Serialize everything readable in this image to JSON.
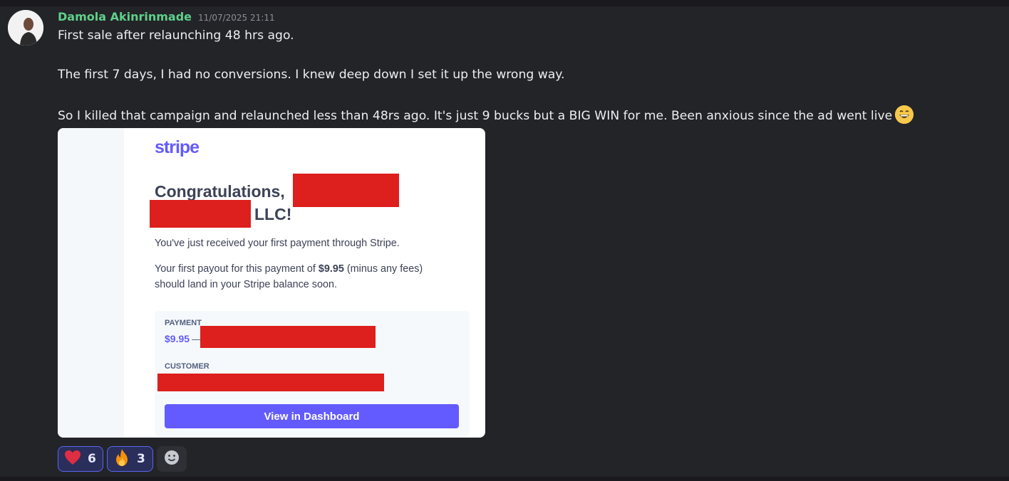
{
  "message": {
    "username": "Damola Akinrinmade",
    "timestamp": "11/07/2025 21:11",
    "lines": [
      "First sale after relaunching 48 hrs ago.",
      "The first 7 days, I had no conversions. I knew deep down I set it up the wrong way.",
      "So I killed that campaign and relaunched less than 48rs ago. It's just 9 bucks but a BIG WIN for me. Been anxious since the ad went live"
    ],
    "trailing_emoji": "grinning-face-icon"
  },
  "embed": {
    "logo": "stripe",
    "congrats": "Congratulations,",
    "llc": "LLC!",
    "p1": "You've just received your first payment through Stripe.",
    "p2_before": "Your first payout for this payment of ",
    "p2_amount": "$9.95",
    "p2_after": " (minus any fees) should land in your Stripe balance soon.",
    "payment_label": "PAYMENT",
    "payment_amount": "$9.95",
    "payment_dash": "—",
    "customer_label": "CUSTOMER",
    "button_label": "View in Dashboard"
  },
  "reactions": [
    {
      "icon": "heart-icon",
      "count": "6"
    },
    {
      "icon": "fire-icon",
      "count": "3"
    }
  ],
  "colors": {
    "background": "#232428",
    "username": "#5fd08a",
    "stripe_brand": "#635bff",
    "redaction": "#dd1f1d",
    "reaction_border": "#5865f2"
  }
}
